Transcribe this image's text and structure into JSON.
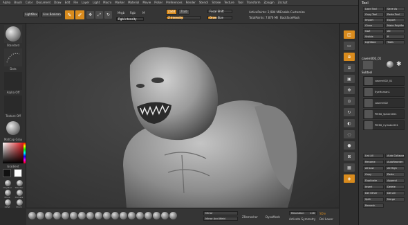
{
  "menubar": {
    "items": [
      "Alpha",
      "Brush",
      "Color",
      "Document",
      "Draw",
      "Edit",
      "File",
      "Layer",
      "Light",
      "Macro",
      "Marker",
      "Material",
      "Movie",
      "Picker",
      "Preferences",
      "Render",
      "Stencil",
      "Stroke",
      "Texture",
      "Tool",
      "Transform",
      "Zplugin",
      "Zscript"
    ]
  },
  "toolbar": {
    "lightbox_label": "LightBox",
    "live_boolean_label": "Live Boolean",
    "edit_label": "Edit",
    "draw_label": "Draw",
    "move_label": "Move",
    "scale_label": "Scale",
    "rotate_label": "Rotate",
    "mrgb_label": "Mrgb",
    "rgb_label": "Rgb",
    "m_label": "M",
    "zadd_label": "Zadd",
    "zsub_label": "Zsub",
    "z_intensity_label": "Z Intensity",
    "rgb_intensity_label": "Rgb Intensity",
    "focal_shift_label": "Focal Shift",
    "draw_size_label": "Draw Size",
    "active_points_label": "ActivePoints: 2,984 Mil",
    "total_points_label": "TotalPoints: 7.876 Mil",
    "enable_customize_label": "Enable Customize",
    "backface_mask_label": "BackfaceMask"
  },
  "left_shelf": {
    "brush_label": "Standard",
    "stroke_label": "Dots",
    "alpha_label": "Alpha Off",
    "texture_label": "Texture Off",
    "material_label": "MatCap Gray",
    "gradient_label": "Gradient",
    "mat_labels": [
      "ClayBuil",
      "Standar",
      "Move",
      "Damsta",
      "Inflat",
      "Pinch",
      "MatCap Gray",
      "MatCap Skin05",
      "MatCap Green"
    ]
  },
  "tool_palette": {
    "title": "Tool",
    "buttons": [
      "Load Tool",
      "Save As",
      "Copy Tool",
      "Paste Tool",
      "Import",
      "Export",
      "Clone",
      "Make PolyMesh3D",
      "GoZ",
      "All",
      "Visible",
      "R",
      "Lightbox",
      "Tools"
    ],
    "tool_name": "cavern002_01",
    "tool_thumbs": [
      "cavern002_0",
      "SphereBrush",
      "Simple",
      "PolyMesh3D"
    ],
    "subtool_header": "Subtool",
    "subtools": [
      "cavern002_01",
      "EyeHuman1",
      "cavern002",
      "PM3D_Sphere001",
      "PM3D_Cylinder001"
    ],
    "lower_buttons": [
      "List All",
      "Auto Collapse",
      "Rename",
      "AutoReorder",
      "All Low",
      "All High",
      "Copy",
      "Paste",
      "Duplicate",
      "Append",
      "Insert",
      "Delete",
      "Del Other",
      "Del All",
      "Split",
      "Merge",
      "Remesh"
    ]
  },
  "right_shelf": {
    "buttons": [
      "Persp",
      "Floor",
      "Local",
      "XYZ",
      "Frame",
      "Move",
      "Zoom3D",
      "Rotate",
      "Transp",
      "Ghost",
      "Solo",
      "Xpose",
      "PolyF",
      "Dynamic"
    ]
  },
  "bottom_bar": {
    "brush_icons": [
      "ClayBuildup",
      "Standard",
      "Move",
      "hPolish",
      "TrimDynamic",
      "Inflat",
      "Pinch",
      "DamStandard",
      "Blob",
      "Flatten",
      "Clay",
      "Slash3",
      "Layer",
      "Nudge",
      "Smooth",
      "Magnify",
      "Planar",
      "SnakeHook"
    ],
    "mirror_label": "Mirror",
    "mirror_and_weld_label": "Mirror And Weld",
    "zremesher_label": "ZRemesher",
    "dynamesh_label": "DynaMesh",
    "resolution_label": "Resolution",
    "resolution_value": "128",
    "activate_symmetry_label": "Activate Symmetry",
    "sdiv_label": "SDiv",
    "del_lower_label": "Del Lower",
    "del_higher_label": "Del Higher"
  },
  "colors": {
    "accent": "#d98b1d",
    "panel": "#383838",
    "viewport": "#3b3b3b"
  }
}
